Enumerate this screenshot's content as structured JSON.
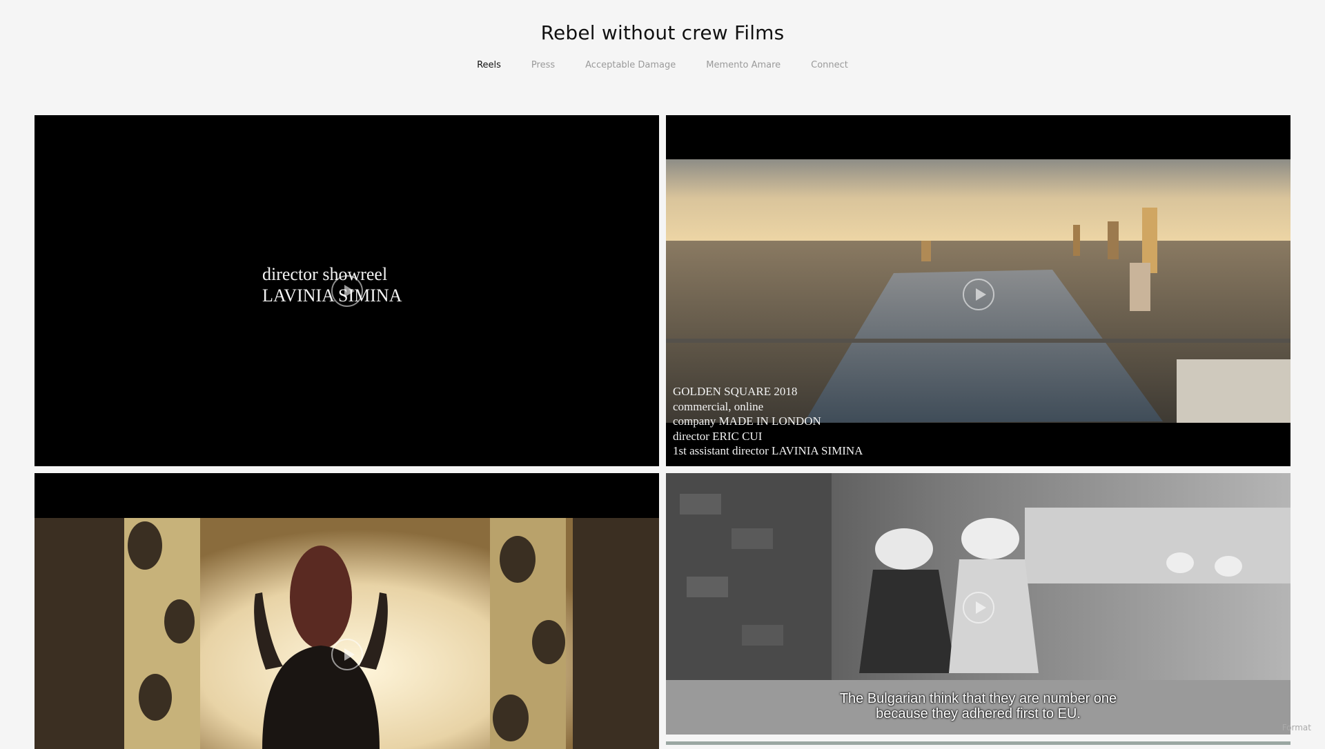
{
  "site": {
    "title": "Rebel without crew Films"
  },
  "nav": [
    {
      "label": "Reels",
      "active": true
    },
    {
      "label": "Press",
      "active": false
    },
    {
      "label": "Acceptable Damage",
      "active": false
    },
    {
      "label": "Memento Amare",
      "active": false
    },
    {
      "label": "Connect",
      "active": false
    }
  ],
  "reels": [
    {
      "title_line1": "director showreel",
      "title_line2": "LAVINIA SIMINA"
    },
    {
      "credits": [
        "GOLDEN SQUARE 2018",
        "commercial, online",
        "company MADE IN LONDON",
        "director ERIC CUI",
        "1st  assistant director LAVINIA SIMINA"
      ]
    },
    {},
    {
      "subtitle_line1": "The Bulgarian think that they are number one",
      "subtitle_line2": "because they adhered first to EU."
    }
  ],
  "footer": {
    "format_credit": "Format"
  },
  "colors": {
    "background": "#f5f5f5",
    "nav_active": "#111111",
    "nav_inactive": "#9a9a9a"
  }
}
